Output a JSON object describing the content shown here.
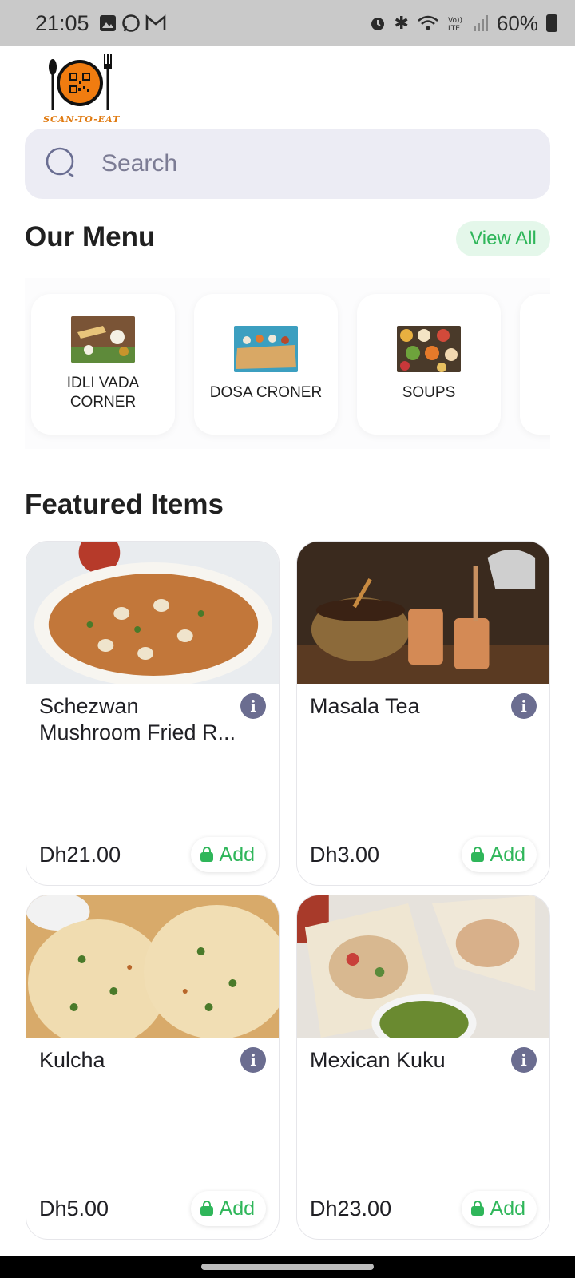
{
  "status_bar": {
    "time": "21:05",
    "battery": "60%",
    "left_icons": [
      "image-icon",
      "whatsapp-icon",
      "gmail-icon"
    ],
    "right_icons": [
      "alarm-icon",
      "bluetooth-icon",
      "wifi-icon",
      "volte-icon",
      "signal-icon",
      "battery-icon"
    ]
  },
  "logo": {
    "text": "SCAN-TO-EAT"
  },
  "search": {
    "placeholder": "Search"
  },
  "menu": {
    "title": "Our Menu",
    "view_all": "View All",
    "categories": [
      {
        "label": "IDLI VADA CORNER"
      },
      {
        "label": "DOSA CRONER"
      },
      {
        "label": "SOUPS"
      }
    ]
  },
  "featured": {
    "title": "Featured Items",
    "add_label": "Add",
    "items": [
      {
        "name": "Schezwan Mushroom Fried R...",
        "price": "Dh21.00"
      },
      {
        "name": "Masala Tea",
        "price": "Dh3.00"
      },
      {
        "name": "Kulcha",
        "price": "Dh5.00"
      },
      {
        "name": "Mexican Kuku",
        "price": "Dh23.00"
      }
    ]
  },
  "colors": {
    "accent_green": "#2fb65a",
    "search_bg": "#ececf4",
    "info_icon": "#6b6d90",
    "logo_orange": "#e07a10"
  }
}
